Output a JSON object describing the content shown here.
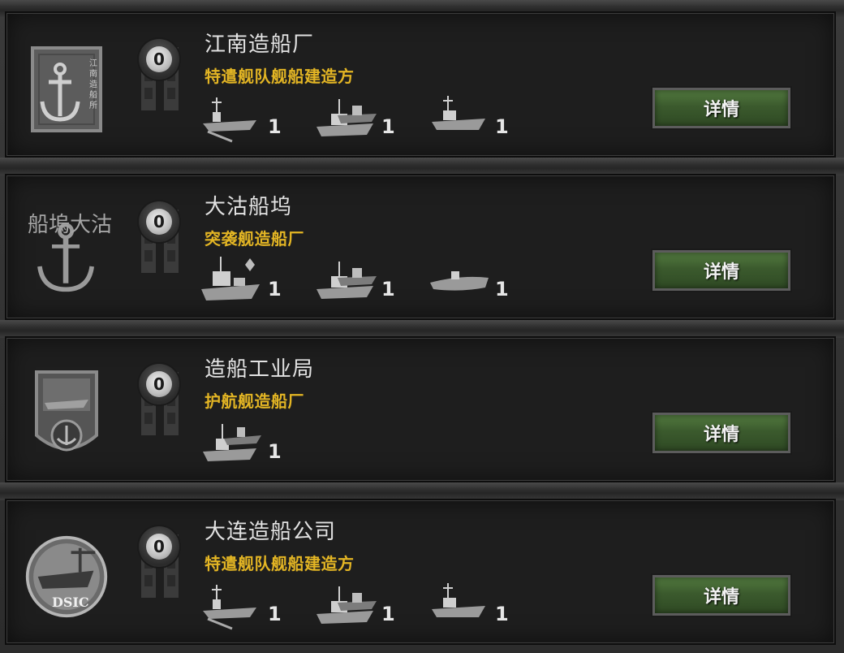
{
  "shipyards": [
    {
      "name": "江南造船厂",
      "type": "特遣舰队舰船建造方",
      "count": "0",
      "logo_icon": "anchor-seal-icon",
      "logo_text": "江南造船所",
      "ships": [
        {
          "icon": "carrier-icon",
          "count": "1"
        },
        {
          "icon": "battleship-group-icon",
          "count": "1"
        },
        {
          "icon": "destroyer-icon",
          "count": "1"
        }
      ],
      "detail_label": "详情"
    },
    {
      "name": "大沽船坞",
      "type": "突袭舰造船厂",
      "count": "0",
      "logo_icon": "anchor-emblem-icon",
      "logo_text": "船塢大沽",
      "ships": [
        {
          "icon": "heavy-battleship-icon",
          "count": "1"
        },
        {
          "icon": "battleship-group-icon",
          "count": "1"
        },
        {
          "icon": "submarine-icon",
          "count": "1"
        }
      ],
      "detail_label": "详情"
    },
    {
      "name": "造船工业局",
      "type": "护航舰造船厂",
      "count": "0",
      "logo_icon": "ship-shield-icon",
      "logo_text": "",
      "ships": [
        {
          "icon": "escort-group-icon",
          "count": "1"
        }
      ],
      "detail_label": "详情"
    },
    {
      "name": "大连造船公司",
      "type": "特遣舰队舰船建造方",
      "count": "0",
      "logo_icon": "dsic-badge-icon",
      "logo_text": "DSIC",
      "ships": [
        {
          "icon": "carrier-icon",
          "count": "1"
        },
        {
          "icon": "battleship-group-icon",
          "count": "1"
        },
        {
          "icon": "destroyer-icon",
          "count": "1"
        }
      ],
      "detail_label": "详情"
    }
  ],
  "colors": {
    "accent_yellow": "#e3b524",
    "button_green": "#3b5a2d",
    "panel_bg": "#1e1e1e"
  }
}
